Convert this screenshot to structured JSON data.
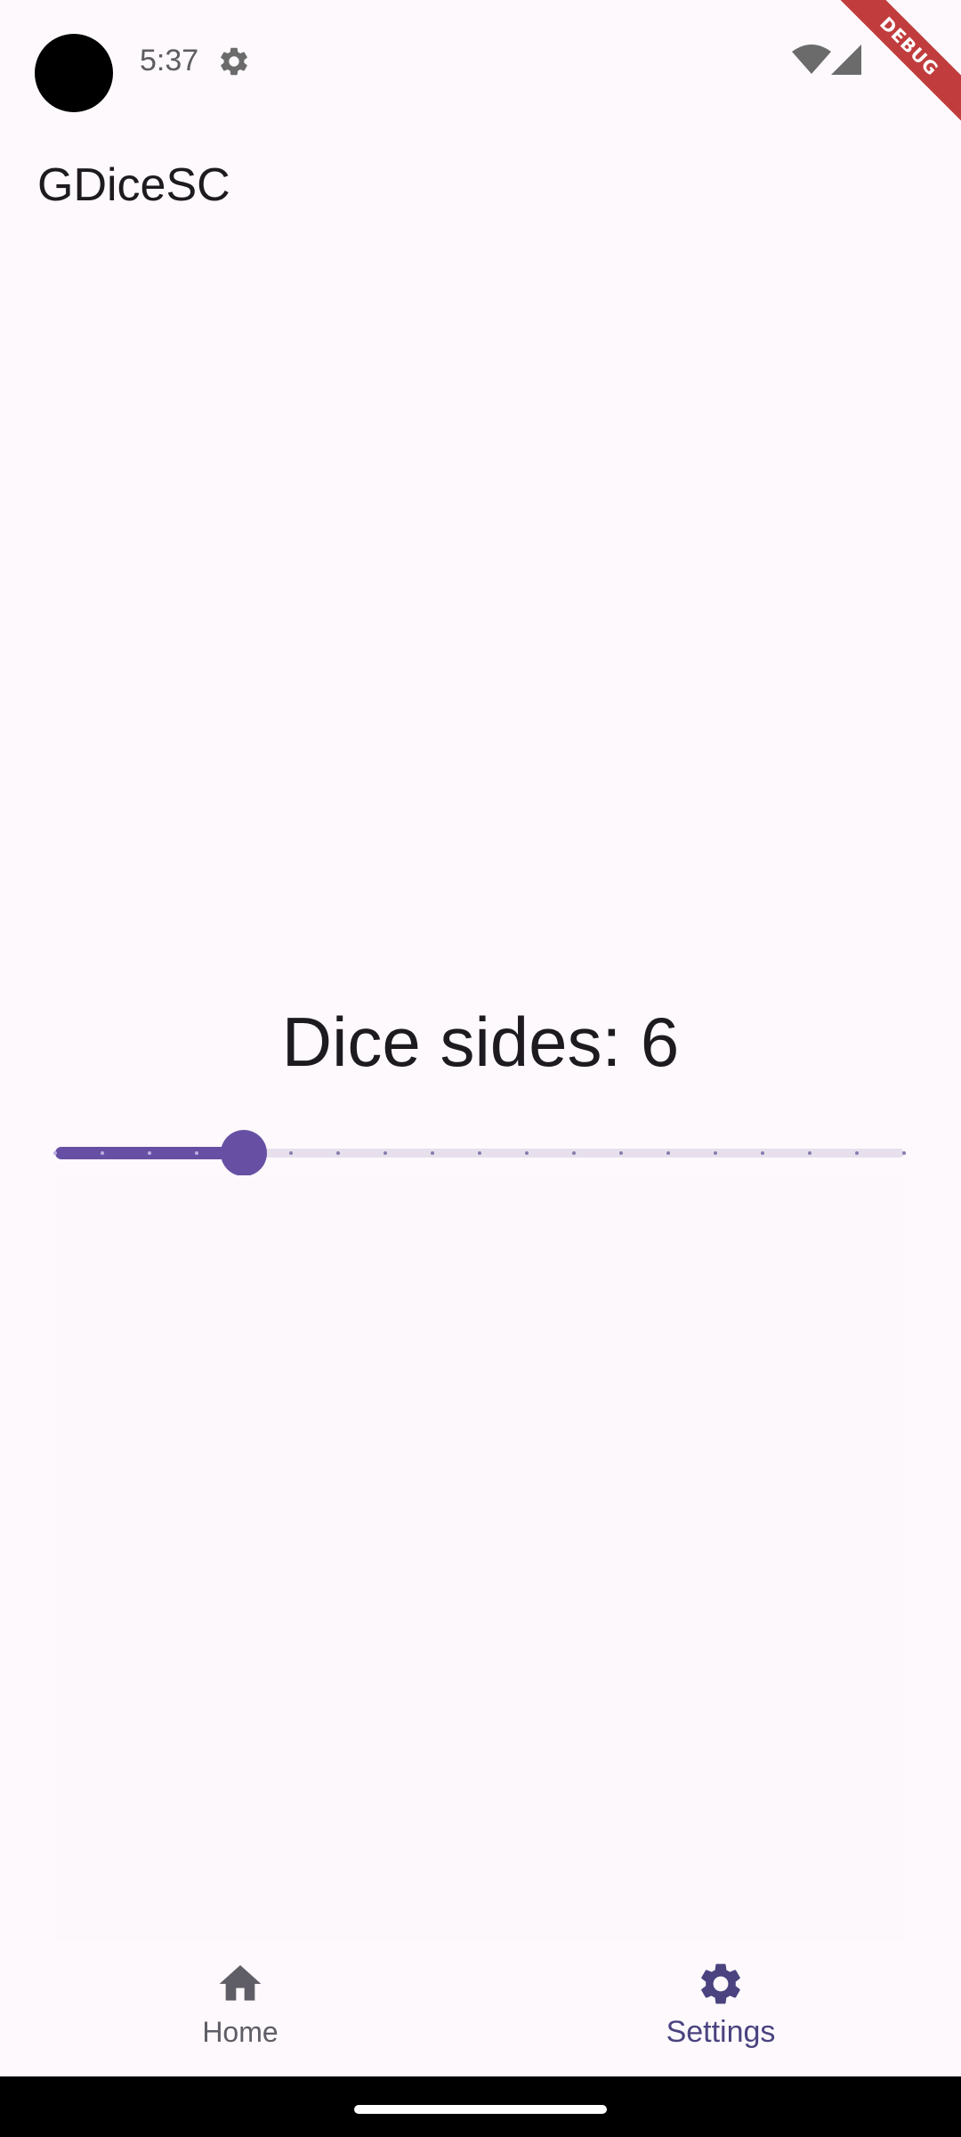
{
  "status_bar": {
    "time": "5:37",
    "icons": [
      "settings-gear-icon",
      "wifi-icon",
      "cell-signal-icon"
    ]
  },
  "debug_banner": "DEBUG",
  "app_bar": {
    "title": "GDiceSC"
  },
  "settings": {
    "dice_sides_label": "Dice sides: 6",
    "slider": {
      "value": 6,
      "min": 2,
      "max": 20,
      "fraction": 0.2222,
      "divisions": 18
    }
  },
  "bottom_nav": {
    "items": [
      {
        "label": "Home",
        "icon": "home-icon",
        "selected": false
      },
      {
        "label": "Settings",
        "icon": "settings-icon",
        "selected": true
      }
    ]
  },
  "colors": {
    "accent": "#6750a4",
    "background": "#fdf9fc",
    "track_inactive": "#e7e0ec",
    "selected_nav": "#4a4380",
    "debug_ribbon": "#b71c1c"
  }
}
